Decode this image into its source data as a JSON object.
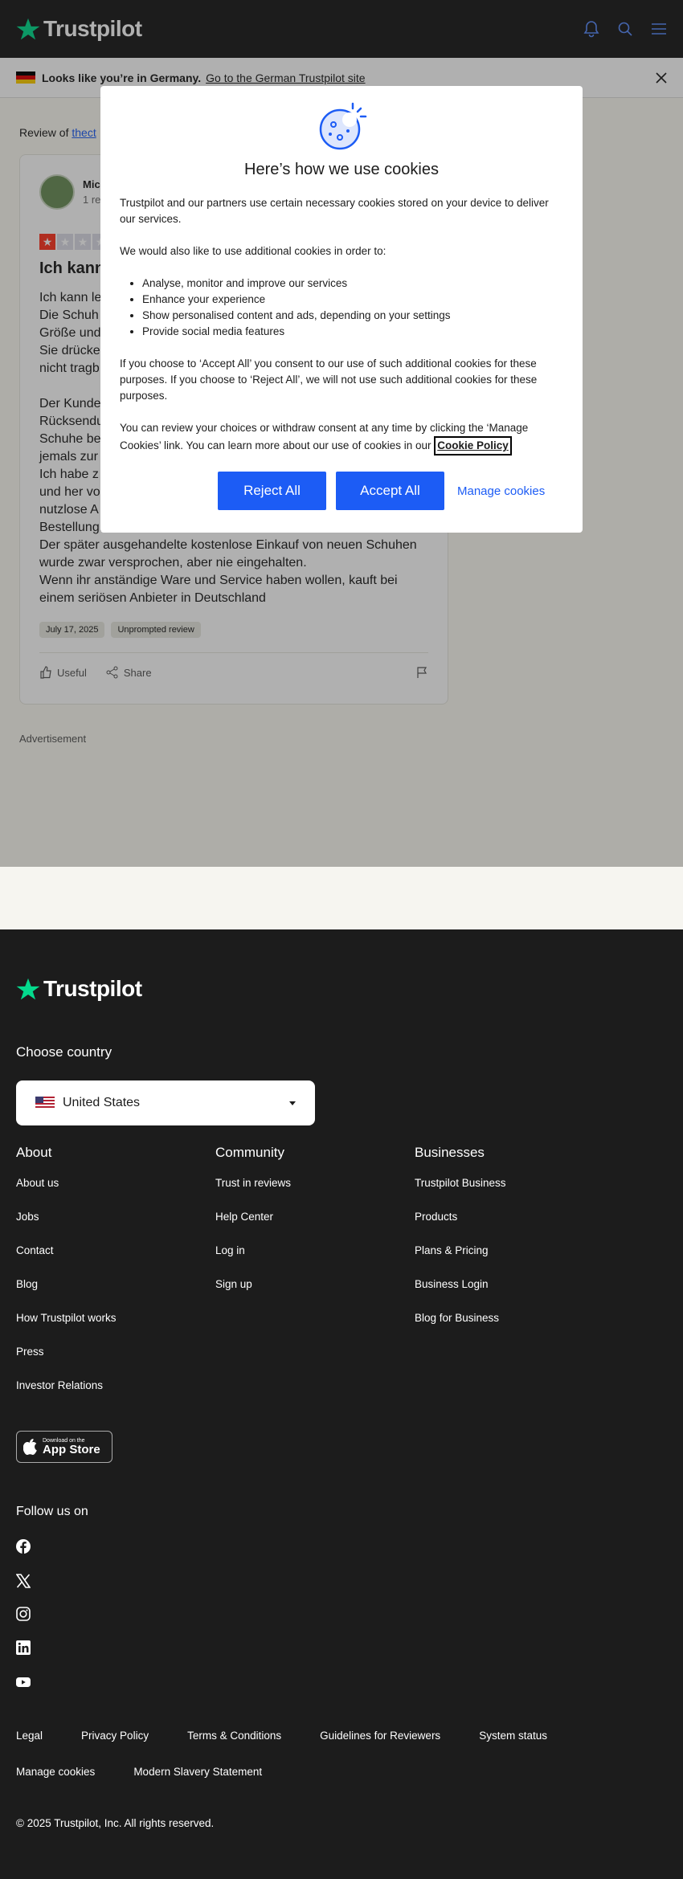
{
  "header": {
    "logo_text": "Trustpilot"
  },
  "geo_banner": {
    "text": "Looks like you’re in Germany.",
    "link": "Go to the German Trustpilot site"
  },
  "main": {
    "review_of_prefix": "Review of",
    "review_of_link": "thect",
    "reviewer_name": "Mic",
    "reviewer_count": "1 rev",
    "rating": 1,
    "title": "Ich kann l",
    "body_lines": [
      "Ich kann le",
      "Die Schuh",
      "Größe und",
      "Sie drücke",
      "nicht tragb",
      "",
      "Der Kunde",
      "Rücksendu",
      "Schuhe be",
      "jemals zur",
      "Ich habe z",
      "und her vo",
      "nutzlose A",
      "Bestellung.",
      "Der später ausgehandelte kostenlose Einkauf von neuen Schuhen",
      "wurde zwar versprochen, aber nie eingehalten.",
      "Wenn ihr anständige Ware und Service haben wollen, kauft bei",
      "einem seriösen Anbieter in Deutschland"
    ],
    "date_tag": "July 17, 2025",
    "unprompted_tag": "Unprompted review",
    "useful_label": "Useful",
    "share_label": "Share",
    "advertisement": "Advertisement"
  },
  "cookie": {
    "title": "Here’s how we use cookies",
    "p1": "Trustpilot and our partners use certain necessary cookies stored on your device to deliver our services.",
    "p2": "We would also like to use additional cookies in order to:",
    "list": [
      "Analyse, monitor and improve our services",
      "Enhance your experience",
      "Show personalised content and ads, depending on your settings",
      "Provide social media features"
    ],
    "p3": "If you choose to ‘Accept All’ you consent to our use of such additional cookies for these purposes. If you choose to ‘Reject All’, we will not use such additional cookies for these purposes.",
    "p4": "You can review your choices or withdraw consent at any time by clicking the ‘Manage Cookies’ link. You can learn more about our use of cookies in our",
    "policy_link": "Cookie Policy",
    "reject": "Reject All",
    "accept": "Accept All",
    "manage": "Manage cookies"
  },
  "footer": {
    "logo_text": "Trustpilot",
    "choose_country": "Choose country",
    "country": "United States",
    "about": {
      "heading": "About",
      "links": [
        "About us",
        "Jobs",
        "Contact",
        "Blog",
        "How Trustpilot works",
        "Press",
        "Investor Relations"
      ]
    },
    "community": {
      "heading": "Community",
      "links": [
        "Trust in reviews",
        "Help Center",
        "Log in",
        "Sign up"
      ]
    },
    "businesses": {
      "heading": "Businesses",
      "links": [
        "Trustpilot Business",
        "Products",
        "Plans & Pricing",
        "Business Login",
        "Blog for Business"
      ]
    },
    "app_store_small": "Download on the",
    "app_store_big": "App Store",
    "follow": "Follow us on",
    "legal_row1": [
      "Legal",
      "Privacy Policy",
      "Terms & Conditions",
      "Guidelines for Reviewers",
      "System status"
    ],
    "legal_row2": [
      "Manage cookies",
      "Modern Slavery Statement"
    ],
    "copyright": "© 2025 Trustpilot, Inc. All rights reserved."
  },
  "colors": {
    "brand_green": "#04da8d",
    "accent_blue": "#1c5cf5",
    "star_red": "#ff3722",
    "dark": "#1c1c1c"
  }
}
